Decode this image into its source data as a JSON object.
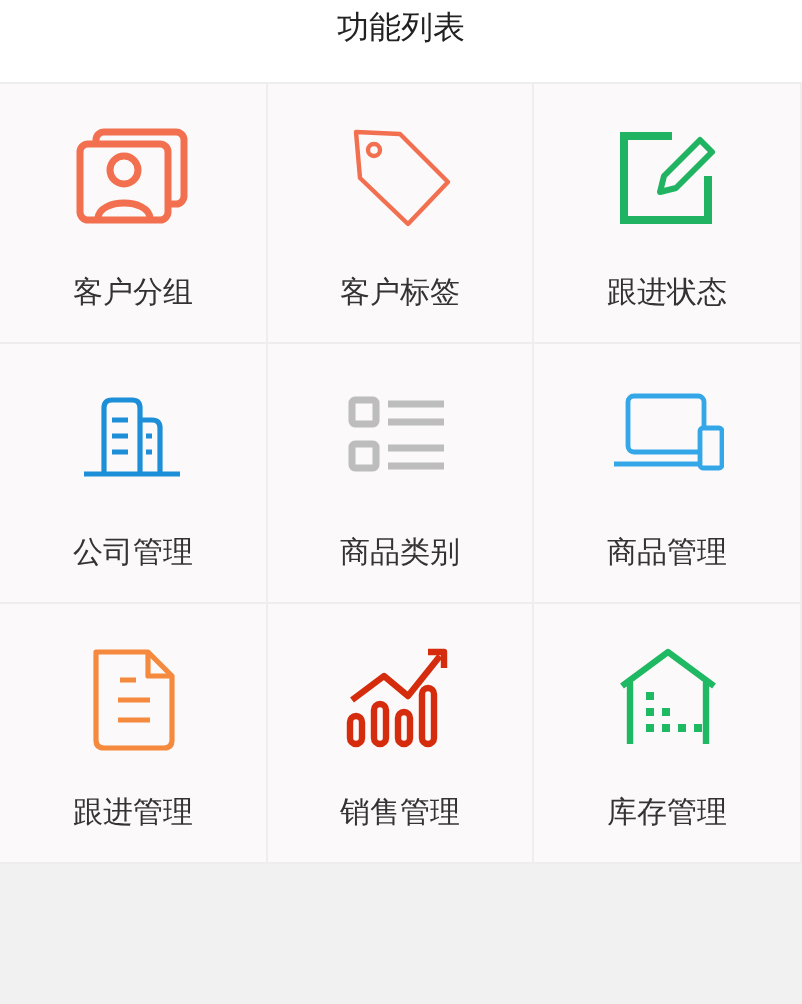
{
  "header": {
    "title": "功能列表"
  },
  "items": [
    {
      "label": "客户分组"
    },
    {
      "label": "客户标签"
    },
    {
      "label": "跟进状态"
    },
    {
      "label": "公司管理"
    },
    {
      "label": "商品类别"
    },
    {
      "label": "商品管理"
    },
    {
      "label": "跟进管理"
    },
    {
      "label": "销售管理"
    },
    {
      "label": "库存管理"
    }
  ]
}
